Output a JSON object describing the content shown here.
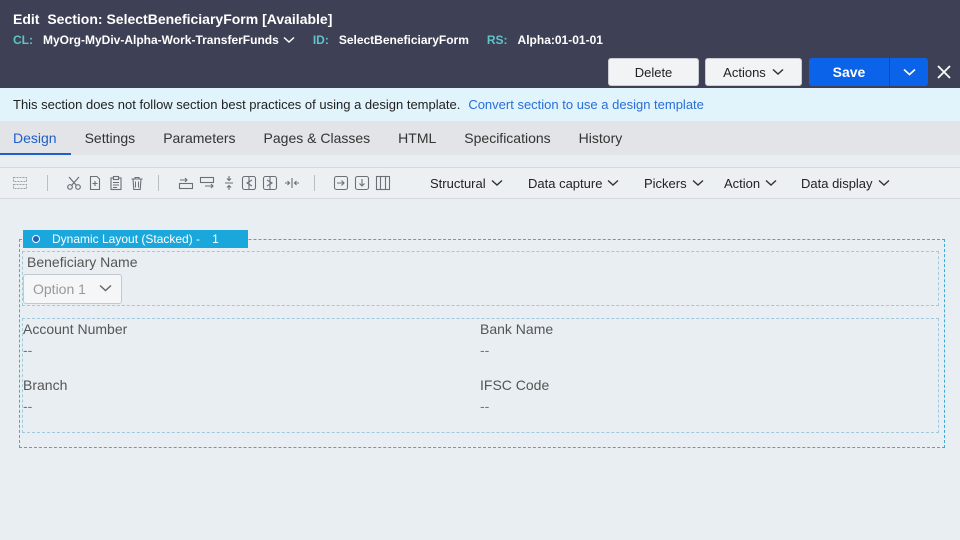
{
  "header": {
    "title_prefix": "Edit",
    "title": "Section: SelectBeneficiaryForm",
    "status": "[Available]",
    "cl_label": "CL:",
    "cl_value": "MyOrg-MyDiv-Alpha-Work-TransferFunds",
    "id_label": "ID:",
    "id_value": "SelectBeneficiaryForm",
    "rs_label": "RS:",
    "rs_value": "Alpha:01-01-01"
  },
  "buttons": {
    "delete": "Delete",
    "actions": "Actions",
    "save": "Save"
  },
  "banner": {
    "message": "This section does not follow section best practices of using a design template.",
    "link": "Convert section to use a design template"
  },
  "tabs": [
    {
      "label": "Design",
      "active": true
    },
    {
      "label": "Settings"
    },
    {
      "label": "Parameters"
    },
    {
      "label": "Pages & Classes"
    },
    {
      "label": "HTML"
    },
    {
      "label": "Specifications"
    },
    {
      "label": "History"
    }
  ],
  "toolbar": {
    "menus": [
      "Structural",
      "Data capture",
      "Pickers",
      "Action",
      "Data display"
    ]
  },
  "layout": {
    "tag_label": "Dynamic Layout (Stacked) -",
    "tag_count": "1",
    "fields": {
      "beneficiary_name": {
        "label": "Beneficiary Name",
        "placeholder": "Option 1"
      },
      "account_number": {
        "label": "Account Number",
        "value": "--"
      },
      "bank_name": {
        "label": "Bank Name",
        "value": "--"
      },
      "branch": {
        "label": "Branch",
        "value": "--"
      },
      "ifsc_code": {
        "label": "IFSC Code",
        "value": "--"
      }
    }
  },
  "colors": {
    "header_bg": "#3e4155",
    "accent_teal": "#5fc4c9",
    "primary_blue": "#0a63e8",
    "banner_bg": "#e1f3fb",
    "layout_tag": "#1aa7dc"
  }
}
